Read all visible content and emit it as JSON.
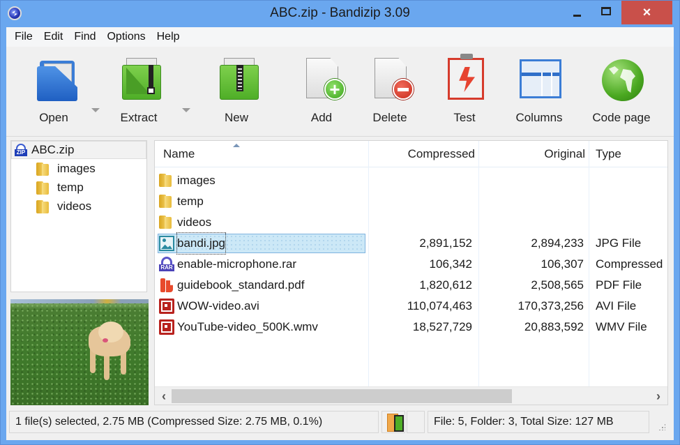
{
  "window": {
    "title": "ABC.zip - Bandizip 3.09",
    "controls": {
      "minimize": "minimize",
      "maximize": "maximize",
      "close": "×"
    }
  },
  "menu": [
    "File",
    "Edit",
    "Find",
    "Options",
    "Help"
  ],
  "toolbar": {
    "open": "Open",
    "extract": "Extract",
    "new": "New",
    "add": "Add",
    "delete": "Delete",
    "test": "Test",
    "columns": "Columns",
    "code_page": "Code page"
  },
  "tree": {
    "root": "ABC.zip",
    "children": [
      "images",
      "temp",
      "videos"
    ]
  },
  "list": {
    "columns": {
      "name": "Name",
      "compressed": "Compressed",
      "original": "Original",
      "type": "Type"
    },
    "sort": {
      "column": "Name",
      "direction": "ascending"
    },
    "rows": [
      {
        "name": "images",
        "icon": "folder-icon",
        "compressed": "",
        "original": "",
        "type": ""
      },
      {
        "name": "temp",
        "icon": "folder-icon",
        "compressed": "",
        "original": "",
        "type": ""
      },
      {
        "name": "videos",
        "icon": "folder-icon",
        "compressed": "",
        "original": "",
        "type": ""
      },
      {
        "name": "bandi.jpg",
        "icon": "image-file-icon",
        "compressed": "2,891,152",
        "original": "2,894,233",
        "type": "JPG File",
        "selected": true
      },
      {
        "name": "enable-microphone.rar",
        "icon": "rar-file-icon",
        "compressed": "106,342",
        "original": "106,307",
        "type": "Compressed"
      },
      {
        "name": "guidebook_standard.pdf",
        "icon": "pdf-file-icon",
        "compressed": "1,820,612",
        "original": "2,508,565",
        "type": "PDF File"
      },
      {
        "name": "WOW-video.avi",
        "icon": "video-file-icon",
        "compressed": "110,074,463",
        "original": "170,373,256",
        "type": "AVI File"
      },
      {
        "name": "YouTube-video_500K.wmv",
        "icon": "video-file-icon",
        "compressed": "18,527,729",
        "original": "20,883,592",
        "type": "WMV File"
      }
    ]
  },
  "scrollbar": {
    "left": "‹",
    "right": "›"
  },
  "status": {
    "selection": "1 file(s) selected, 2.75 MB (Compressed Size: 2.75 MB, 0.1%)",
    "summary": "File: 5, Folder: 3, Total Size: 127 MB"
  },
  "colors": {
    "titlebar": "#6aa7ef",
    "close_button": "#c9504a",
    "selection": "#cce8f7"
  }
}
